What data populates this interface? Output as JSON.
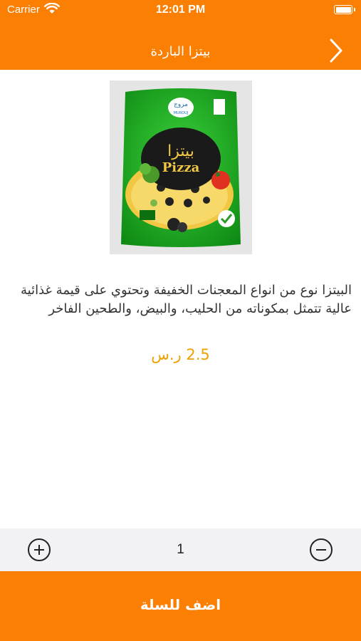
{
  "status_bar": {
    "carrier": "Carrier",
    "time": "12:01 PM"
  },
  "nav": {
    "title": "بيتزا الباردة",
    "back_icon": "chevron-right-icon"
  },
  "product": {
    "image_icon": "pizza-package-image",
    "description": "البيتزا نوع من انواع المعجنات الخفيفة وتحتوي على قيمة غذائية عالية تتمثل بمكوناته من الحليب، والبيض، والطحين الفاخر",
    "price": "2.5 ر.س",
    "price_color": "#f0a000"
  },
  "quantity": {
    "value": "1",
    "plus_icon": "plus-circle-icon",
    "minus_icon": "minus-circle-icon"
  },
  "cart": {
    "add_label": "اضف للسلة"
  },
  "theme": {
    "accent": "#fb7f02",
    "qty_bar_bg": "#f2f2f6"
  },
  "package_art": {
    "brand_ar": "مروج",
    "brand_en": "MUROUJ",
    "title_ar": "بيتزا",
    "title_en": "Pizza"
  }
}
